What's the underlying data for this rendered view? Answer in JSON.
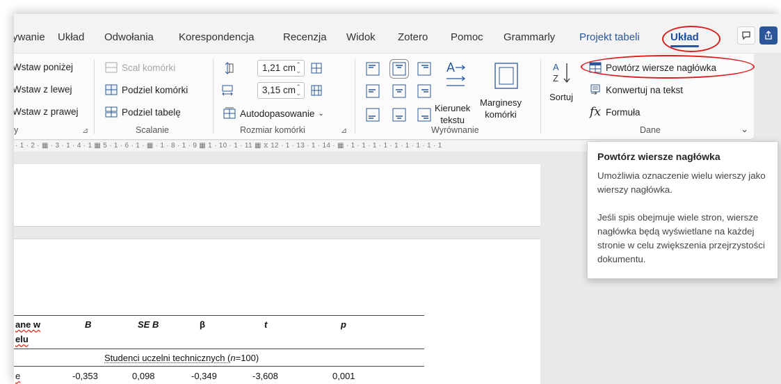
{
  "tabs": [
    {
      "label": "ywanie"
    },
    {
      "label": "Układ"
    },
    {
      "label": "Odwołania"
    },
    {
      "label": "Korespondencja"
    },
    {
      "label": "Recenzja"
    },
    {
      "label": "Widok"
    },
    {
      "label": "Zotero"
    },
    {
      "label": "Pomoc"
    },
    {
      "label": "Grammarly"
    },
    {
      "label": "Projekt tabeli"
    },
    {
      "label": "Układ"
    }
  ],
  "insert_group": {
    "below": "Wstaw poniżej",
    "left": "Wstaw z lewej",
    "right": "Wstaw z prawej",
    "label": "y"
  },
  "merge_group": {
    "merge_cells": "Scal komórki",
    "split_cells": "Podziel komórki",
    "split_table": "Podziel tabelę",
    "label": "Scalanie"
  },
  "cell_size_group": {
    "height_value": "1,21 cm",
    "width_value": "3,15 cm",
    "autofit": "Autodopasowanie",
    "label": "Rozmiar komórki"
  },
  "alignment_group": {
    "text_direction_line1": "Kierunek",
    "text_direction_line2": "tekstu",
    "cell_margins_line1": "Marginesy",
    "cell_margins_line2": "komórki",
    "label": "Wyrównanie"
  },
  "data_group": {
    "sort": "Sortuj",
    "repeat_header_rows": "Powtórz wiersze nagłówka",
    "convert_to_text": "Konwertuj na tekst",
    "formula": "Formuła",
    "label": "Dane"
  },
  "ruler_text": "· 1 · 2 · ▦ · 3 · 1 · 4 · 1 ▦ 5 · 1 · 6 · 1 · ▦ · 1 · 8 · 1 · 9 ▦ 1 · 10 · 1 · 11 ▦ ⧖ 12 · 1 · 13 · 1 · 14 · ▦ · 1 · 1 · 1 · 1 · 1 · 1 · 1 · 1 · 1",
  "table": {
    "headers": [
      "ane w",
      "B",
      "SE B",
      "β",
      "t",
      "p"
    ],
    "header_line2": "elu",
    "subheader_prefix": "Studenci uczelni technicznych (",
    "subheader_n": "n",
    "subheader_suffix": "=100)",
    "row1": [
      "e",
      "-0,353",
      "0,098",
      "-0,349",
      "-3,608",
      "0,001"
    ]
  },
  "tooltip": {
    "title": "Powtórz wiersze nagłówka",
    "para1": "Umożliwia oznaczenie wielu wierszy jako wierszy nagłówka.",
    "para2": "Jeśli spis obejmuje wiele stron, wiersze nagłówka będą wyświetlane na każdej stronie w celu zwiększenia przejrzystości dokumentu."
  },
  "colors": {
    "accent": "#2b579a",
    "highlight_oval": "#d81e1e"
  }
}
